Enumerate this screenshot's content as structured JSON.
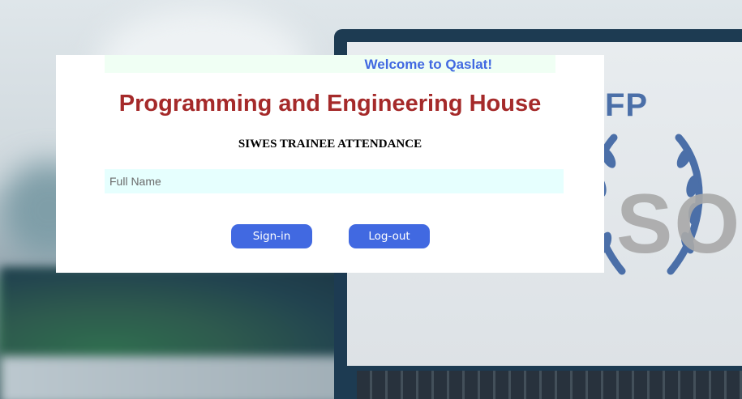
{
  "welcome_text": "Welcome to Qaslat!",
  "title": "Programming and Engineering House",
  "subtitle": "SIWES TRAINEE ATTENDANCE",
  "form": {
    "full_name_placeholder": "Full Name",
    "full_name_value": ""
  },
  "buttons": {
    "signin_label": "Sign-in",
    "logout_label": "Log-out"
  },
  "background": {
    "logo_text": "FP",
    "large_text": "SO"
  },
  "colors": {
    "accent": "#4169e1",
    "title": "#a52a2a",
    "input_bg": "#e6fffe",
    "welcome_bar_bg": "#f0fff4"
  }
}
